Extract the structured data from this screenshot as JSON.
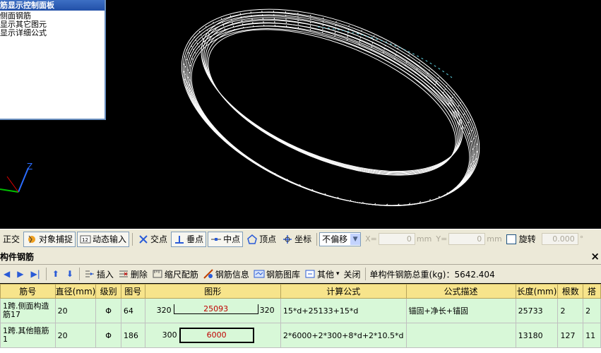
{
  "viewport": {
    "panel_title": "筋显示控制面板",
    "panel_items": [
      "侧面钢筋",
      "显示其它图元",
      "显示详细公式"
    ],
    "axis_z": "Z"
  },
  "statusbar": {
    "ortho": "正交",
    "snap": "对象捕捉",
    "dyn_input": "动态输入",
    "intersect": "交点",
    "perp": "垂点",
    "mid": "中点",
    "vertex": "顶点",
    "coord": "坐标",
    "offset_select": "不偏移",
    "x_label": "X=",
    "x_value": "0",
    "y_label": "Y=",
    "y_value": "0",
    "unit": "mm",
    "rotate_label": "旋转",
    "rotate_value": "0.000",
    "degree": "°"
  },
  "subpanel": {
    "title": "构件钢筋",
    "close": "×"
  },
  "toolbar": {
    "insert": "插入",
    "delete": "删除",
    "scale": "缩尺配筋",
    "info": "钢筋信息",
    "library": "钢筋图库",
    "other": "其他",
    "close": "关闭",
    "total_weight": "单构件钢筋总重(kg)：5642.404"
  },
  "table": {
    "headers": [
      "筋号",
      "直径(mm)",
      "级别",
      "图号",
      "图形",
      "计算公式",
      "公式描述",
      "长度(mm)",
      "根数",
      "搭"
    ],
    "rows": [
      {
        "name": "1跨.侧面构造筋17",
        "diameter": "20",
        "grade": "Φ",
        "figure": "64",
        "shape_left": "320",
        "shape_mid": "25093",
        "shape_right": "320",
        "formula": "15*d+25133+15*d",
        "desc": "锚固+净长+锚固",
        "length": "25733",
        "count": "2",
        "lap": "2"
      },
      {
        "name": "1跨.其他箍筋1",
        "diameter": "20",
        "grade": "Φ",
        "figure": "186",
        "shape_left": "300",
        "shape_mid": "6000",
        "shape_right": "",
        "formula": "2*6000+2*300+8*d+2*10.5*d",
        "desc": "",
        "length": "13180",
        "count": "127",
        "lap": "11"
      }
    ]
  }
}
